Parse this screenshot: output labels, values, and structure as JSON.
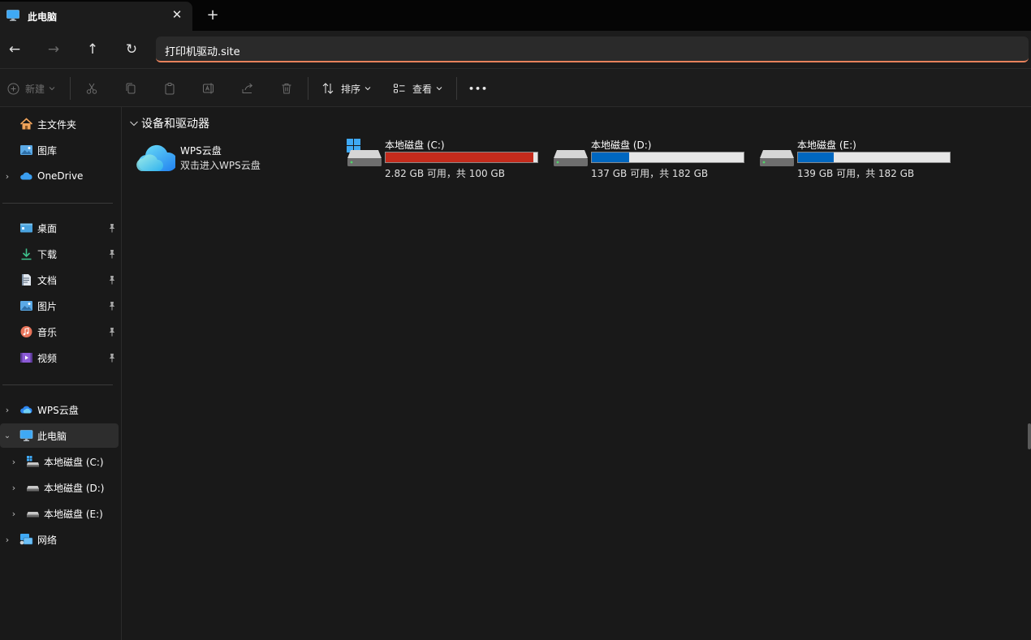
{
  "tab": {
    "title": "此电脑",
    "close_glyph": "✕",
    "new_tab_glyph": "+"
  },
  "nav": {
    "back_glyph": "←",
    "forward_glyph": "→",
    "up_glyph": "↑",
    "refresh_glyph": "↻",
    "address_value": "打印机驱动.site"
  },
  "toolbar": {
    "new_label": "新建",
    "sort_label": "排序",
    "view_label": "查看",
    "more_glyph": "•••"
  },
  "sidebar": {
    "top_items": [
      {
        "label": "主文件夹",
        "icon": "home-icon"
      },
      {
        "label": "图库",
        "icon": "gallery-icon"
      },
      {
        "label": "OneDrive",
        "icon": "onedrive-icon"
      }
    ],
    "pinned_items": [
      {
        "label": "桌面",
        "icon": "desktop-icon"
      },
      {
        "label": "下载",
        "icon": "download-icon"
      },
      {
        "label": "文档",
        "icon": "documents-icon"
      },
      {
        "label": "图片",
        "icon": "pictures-icon"
      },
      {
        "label": "音乐",
        "icon": "music-icon"
      },
      {
        "label": "视频",
        "icon": "videos-icon"
      }
    ],
    "tree_items": [
      {
        "label": "WPS云盘",
        "icon": "wps-cloud-icon"
      },
      {
        "label": "此电脑",
        "icon": "this-pc-icon",
        "selected": true
      },
      {
        "label": "本地磁盘 (C:)",
        "icon": "drive-c-icon"
      },
      {
        "label": "本地磁盘 (D:)",
        "icon": "drive-icon"
      },
      {
        "label": "本地磁盘 (E:)",
        "icon": "drive-icon"
      },
      {
        "label": "网络",
        "icon": "network-icon"
      }
    ]
  },
  "main": {
    "section_title": "设备和驱动器",
    "wps": {
      "name": "WPS云盘",
      "subtitle": "双击进入WPS云盘"
    },
    "drives": [
      {
        "name": "本地磁盘 (C:)",
        "free_text": "2.82 GB 可用，共 100 GB",
        "used_fraction": 0.9718,
        "bar_color": "#c42b1c",
        "system": true
      },
      {
        "name": "本地磁盘 (D:)",
        "free_text": "137 GB 可用，共 182 GB",
        "used_fraction": 0.2473,
        "bar_color": "#0067c0",
        "system": false
      },
      {
        "name": "本地磁盘 (E:)",
        "free_text": "139 GB 可用，共 182 GB",
        "used_fraction": 0.2363,
        "bar_color": "#0067c0",
        "system": false
      }
    ]
  },
  "colors": {
    "accent": "#0067c0",
    "danger": "#c42b1c",
    "address_underline": "#e8825c"
  }
}
